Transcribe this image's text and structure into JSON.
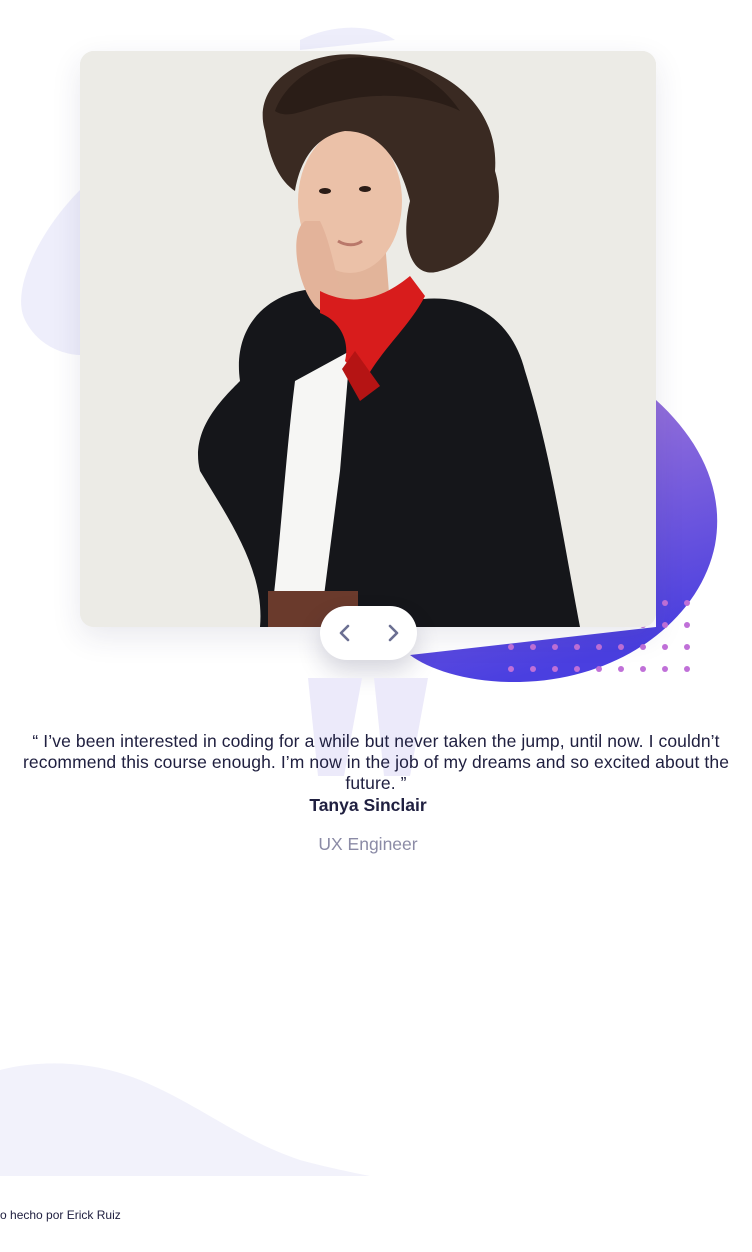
{
  "testimonial": {
    "quote": "“ I’ve been interested in coding for a while but never taken the jump, until now. I couldn’t recommend this course enough. I’m now in the job of my dreams and so excited about the future. ”",
    "name": "Tanya Sinclair",
    "role": "UX Engineer"
  },
  "carousel": {
    "prev_icon": "chevron-left-icon",
    "next_icon": "chevron-right-icon"
  },
  "footer": {
    "credit_text": "eto hecho por",
    "author": "Erick Ruiz"
  },
  "colors": {
    "text_dark": "#202040",
    "text_muted": "#8b8ba6",
    "gradient_start": "#9b6fd8",
    "gradient_end": "#4f46e5",
    "blob_light": "#eeeefb",
    "dots": "#c070d8"
  }
}
